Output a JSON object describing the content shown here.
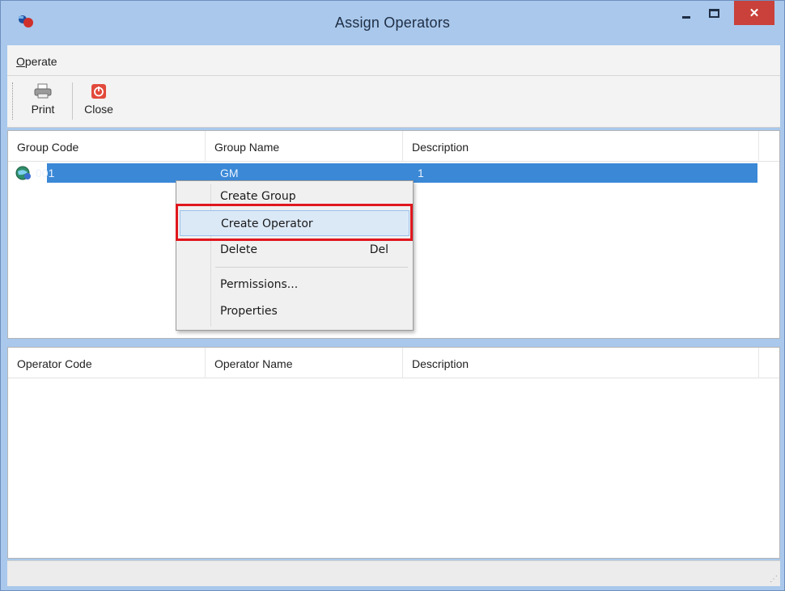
{
  "window": {
    "title": "Assign Operators",
    "close_glyph": "✕",
    "app_icon": "operators-app-icon"
  },
  "menu": {
    "items": [
      {
        "label": "Operate",
        "mnemonic": "O"
      }
    ]
  },
  "toolbar": {
    "print_label": "Print",
    "close_label": "Close",
    "print_icon": "printer-icon",
    "close_icon": "power-close-icon"
  },
  "groups_table": {
    "columns": [
      "Group Code",
      "Group Name",
      "Description"
    ],
    "rows": [
      {
        "code": "001",
        "name": "GM",
        "description": "1",
        "selected": true,
        "icon": "group-globe-icon"
      }
    ]
  },
  "context_menu": {
    "items": [
      {
        "label": "Create Group",
        "shortcut": ""
      },
      {
        "label": "Create Operator",
        "shortcut": "",
        "hovered": true
      },
      {
        "label": "Delete",
        "shortcut": "Del"
      },
      {
        "label": "Permissions...",
        "shortcut": ""
      },
      {
        "label": "Properties",
        "shortcut": ""
      }
    ],
    "highlight_color": "#e0171d"
  },
  "operators_table": {
    "columns": [
      "Operator Code",
      "Operator Name",
      "Description"
    ],
    "rows": []
  },
  "colors": {
    "titlebar": "#a9c8ec",
    "selection": "#3a88d6",
    "close_button": "#c9413a"
  }
}
